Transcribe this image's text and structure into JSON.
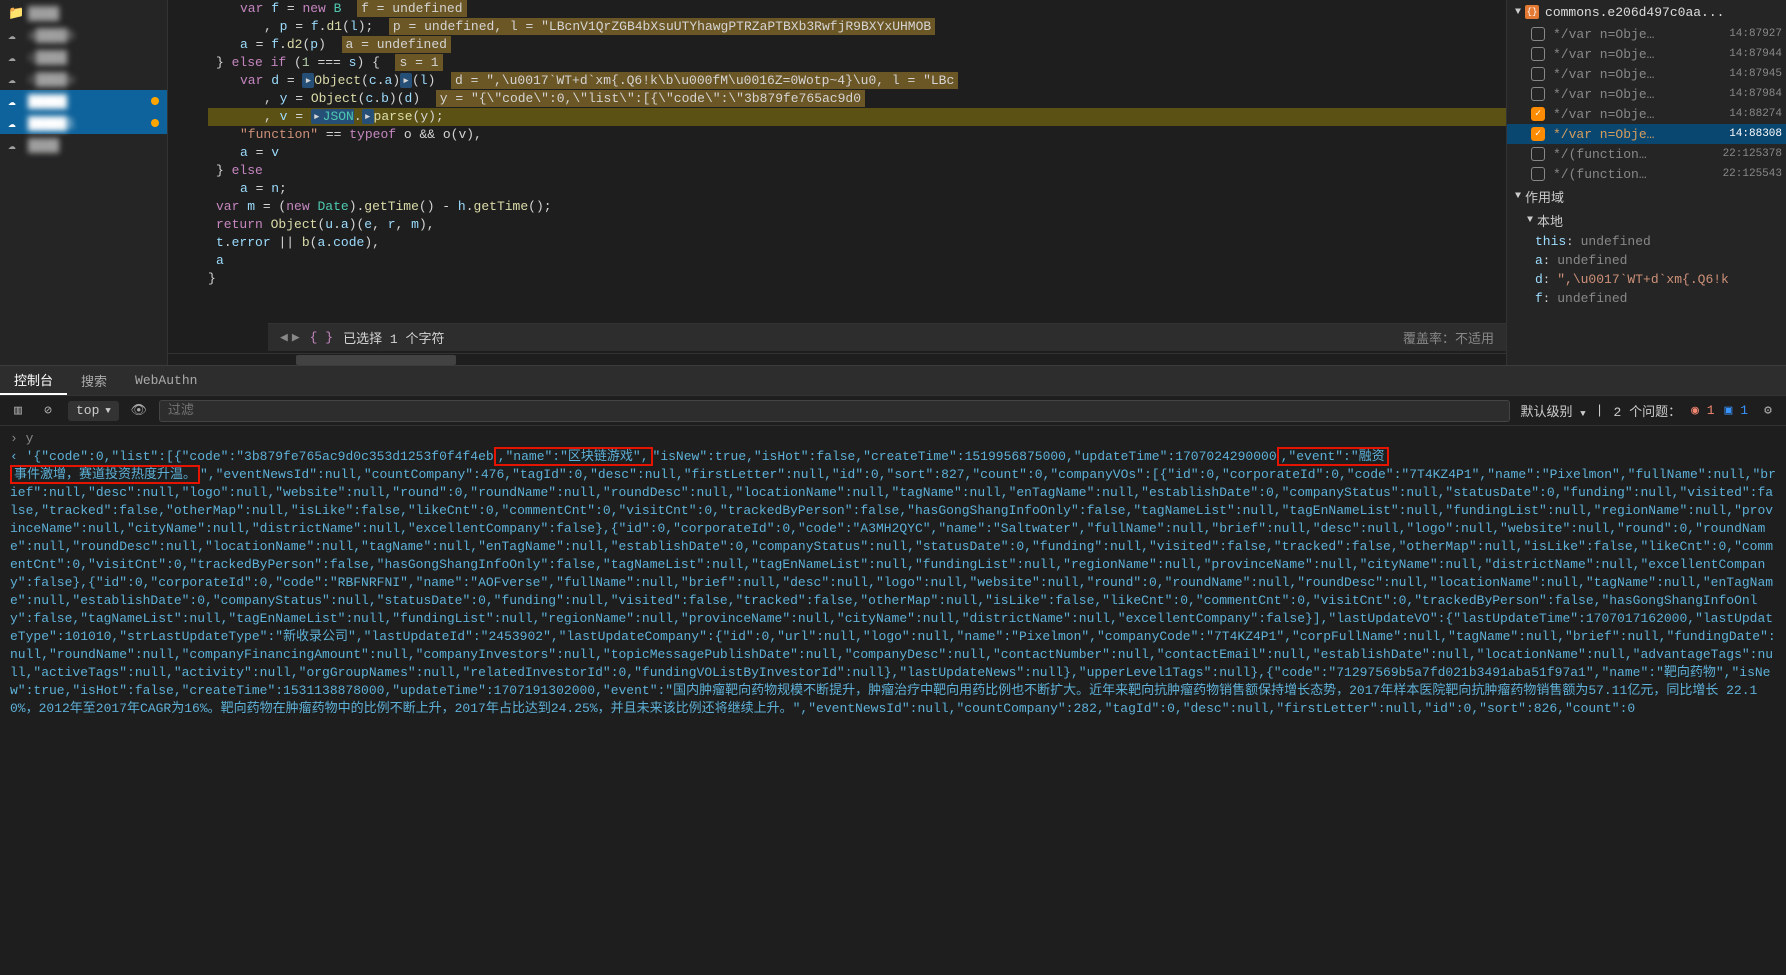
{
  "file_tree": [
    {
      "icon": "folder",
      "label": "████",
      "selected": false
    },
    {
      "icon": "cloud",
      "label": "a████b",
      "selected": false
    },
    {
      "icon": "cloud",
      "label": "c████",
      "selected": false
    },
    {
      "icon": "cloud",
      "label": "c████u",
      "selected": false
    },
    {
      "icon": "cloud",
      "label": "█████",
      "selected": true,
      "dot": "#ffa500"
    },
    {
      "icon": "cloud",
      "label": "█████1",
      "selected": true,
      "dot": "#ffa500"
    },
    {
      "icon": "cloud",
      "label": "████",
      "selected": false
    }
  ],
  "code": {
    "l1": "var f = new B",
    "l1h": "f = undefined",
    "l2a": ", p = f.d1(l);",
    "l2h": "p = undefined, l = \"LBcnV1QrZGB4bXsuUTYhawgPTRZaPTBXb3RwfjR9BXYxUHMOB",
    "l3a": "a = f.d2(p)",
    "l3h": "a = undefined",
    "l4": "} else if (1 === s) {",
    "l4h": "s = 1",
    "l5a": "var d = ",
    "l5b": "Object(c.a)",
    "l5c": "(l)",
    "l5h": "d = \",\\u0017`WT+d`xm{.Q6!k\\b\\u000fM\\u0016Z=0Wotp~4}\\u0, l = \"LBc",
    "l6a": ", y = Object(c.b)(d)",
    "l6h": "y = \"{\\\"code\\\":0,\\\"list\\\":[{\\\"code\\\":\\\"3b879fe765ac9d0",
    "l7a": ", v = ",
    "l7b": "JSON",
    "l7c": ".",
    "l7d": "parse",
    "l7e": "(y);",
    "l8a": "\"function\"",
    "l8b": " == ",
    "l8c": "typeof",
    "l8d": " o && o(v),",
    "l9": "a = v",
    "l10": "} else",
    "l11": "a = n;",
    "l12": "var m = (new Date).getTime() - h.getTime();",
    "l13": "return Object(u.a)(e, r, m),",
    "l14": "t.error || b(a.code),",
    "l15": "a",
    "l16": "}"
  },
  "status": {
    "selection": "已选择 1 个字符",
    "coverage": "覆盖率：不适用"
  },
  "debug": {
    "file_header": "commons.e206d497c0aa...",
    "watch_items": [
      {
        "checked": false,
        "text": "*/var n=Obje…",
        "loc": "14:87927"
      },
      {
        "checked": false,
        "text": "*/var n=Obje…",
        "loc": "14:87944"
      },
      {
        "checked": false,
        "text": "*/var n=Obje…",
        "loc": "14:87945"
      },
      {
        "checked": false,
        "text": "*/var n=Obje…",
        "loc": "14:87984"
      },
      {
        "checked": true,
        "text": "*/var n=Obje…",
        "loc": "14:88274"
      },
      {
        "checked": true,
        "text": "*/var n=Obje…",
        "loc": "14:88308",
        "sel": true
      },
      {
        "checked": false,
        "text": "*/(function…",
        "loc": "22:125378"
      },
      {
        "checked": false,
        "text": "*/(function…",
        "loc": "22:125543"
      }
    ],
    "scope_label": "作用域",
    "local_label": "本地",
    "vars": [
      {
        "k": "this",
        "v": "undefined"
      },
      {
        "k": "a",
        "v": "undefined"
      },
      {
        "k": "d",
        "vs": "\",\\u0017`WT+d`xm{.Q6!k"
      },
      {
        "k": "f",
        "v": "undefined"
      }
    ]
  },
  "console": {
    "tabs": [
      "控制台",
      "搜索",
      "WebAuthn"
    ],
    "active_tab": 0,
    "context": "top",
    "filter_placeholder": "过滤",
    "level": "默认级别",
    "issues_label": "2 个问题：",
    "err_count": "1",
    "info_count": "1",
    "prompt": "y",
    "json_pre": "'{\"code\":0,\"list\":[{\"code\":\"3b879fe765ac9d0c353d1253f0f4f4eb",
    "json_box1": ",\"name\":\"区块链游戏\",",
    "json_mid1": "\"isNew\":true,\"isHot\":false,\"createTime\":1519956875000,\"updateTime\":1707024290000",
    "json_box2": ",\"event\":\"融资",
    "json_box3": "事件激增，赛道投资热度升温。",
    "json_rest": "\",\"eventNewsId\":null,\"countCompany\":476,\"tagId\":0,\"desc\":null,\"firstLetter\":null,\"id\":0,\"sort\":827,\"count\":0,\"companyVOs\":[{\"id\":0,\"corporateId\":0,\"code\":\"7T4KZ4P1\",\"name\":\"Pixelmon\",\"fullName\":null,\"brief\":null,\"desc\":null,\"logo\":null,\"website\":null,\"round\":0,\"roundName\":null,\"roundDesc\":null,\"locationName\":null,\"tagName\":null,\"enTagName\":null,\"establishDate\":0,\"companyStatus\":null,\"statusDate\":0,\"funding\":null,\"visited\":false,\"tracked\":false,\"otherMap\":null,\"isLike\":false,\"likeCnt\":0,\"commentCnt\":0,\"visitCnt\":0,\"trackedByPerson\":false,\"hasGongShangInfoOnly\":false,\"tagNameList\":null,\"tagEnNameList\":null,\"fundingList\":null,\"regionName\":null,\"provinceName\":null,\"cityName\":null,\"districtName\":null,\"excellentCompany\":false},{\"id\":0,\"corporateId\":0,\"code\":\"A3MH2QYC\",\"name\":\"Saltwater\",\"fullName\":null,\"brief\":null,\"desc\":null,\"logo\":null,\"website\":null,\"round\":0,\"roundName\":null,\"roundDesc\":null,\"locationName\":null,\"tagName\":null,\"enTagName\":null,\"establishDate\":0,\"companyStatus\":null,\"statusDate\":0,\"funding\":null,\"visited\":false,\"tracked\":false,\"otherMap\":null,\"isLike\":false,\"likeCnt\":0,\"commentCnt\":0,\"visitCnt\":0,\"trackedByPerson\":false,\"hasGongShangInfoOnly\":false,\"tagNameList\":null,\"tagEnNameList\":null,\"fundingList\":null,\"regionName\":null,\"provinceName\":null,\"cityName\":null,\"districtName\":null,\"excellentCompany\":false},{\"id\":0,\"corporateId\":0,\"code\":\"RBFNRFNI\",\"name\":\"AOFverse\",\"fullName\":null,\"brief\":null,\"desc\":null,\"logo\":null,\"website\":null,\"round\":0,\"roundName\":null,\"roundDesc\":null,\"locationName\":null,\"tagName\":null,\"enTagName\":null,\"establishDate\":0,\"companyStatus\":null,\"statusDate\":0,\"funding\":null,\"visited\":false,\"tracked\":false,\"otherMap\":null,\"isLike\":false,\"likeCnt\":0,\"commentCnt\":0,\"visitCnt\":0,\"trackedByPerson\":false,\"hasGongShangInfoOnly\":false,\"tagNameList\":null,\"tagEnNameList\":null,\"fundingList\":null,\"regionName\":null,\"provinceName\":null,\"cityName\":null,\"districtName\":null,\"excellentCompany\":false}],\"lastUpdateVO\":{\"lastUpdateTime\":1707017162000,\"lastUpdateType\":101010,\"strLastUpdateType\":\"新收录公司\",\"lastUpdateId\":\"2453902\",\"lastUpdateCompany\":{\"id\":0,\"url\":null,\"logo\":null,\"name\":\"Pixelmon\",\"companyCode\":\"7T4KZ4P1\",\"corpFullName\":null,\"tagName\":null,\"brief\":null,\"fundingDate\":null,\"roundName\":null,\"companyFinancingAmount\":null,\"companyInvestors\":null,\"topicMessagePublishDate\":null,\"companyDesc\":null,\"contactNumber\":null,\"contactEmail\":null,\"establishDate\":null,\"locationName\":null,\"advantageTags\":null,\"activeTags\":null,\"activity\":null,\"orgGroupNames\":null,\"relatedInvestorId\":0,\"fundingVOListByInvestorId\":null},\"lastUpdateNews\":null},\"upperLevel1Tags\":null},{\"code\":\"71297569b5a7fd021b3491aba51f97a1\",\"name\":\"靶向药物\",\"isNew\":true,\"isHot\":false,\"createTime\":1531138878000,\"updateTime\":1707191302000,\"event\":\"国内肿瘤靶向药物规模不断提升，肿瘤治疗中靶向用药比例也不断扩大。近年来靶向抗肿瘤药物销售额保持增长态势，2017年样本医院靶向抗肿瘤药物销售额为57.11亿元，同比增长 22.10%，2012年至2017年CAGR为16%。靶向药物在肿瘤药物中的比例不断上升，2017年占比达到24.25%，并且未来该比例还将继续上升。\",\"eventNewsId\":null,\"countCompany\":282,\"tagId\":0,\"desc\":null,\"firstLetter\":null,\"id\":0,\"sort\":826,\"count\":0"
  }
}
